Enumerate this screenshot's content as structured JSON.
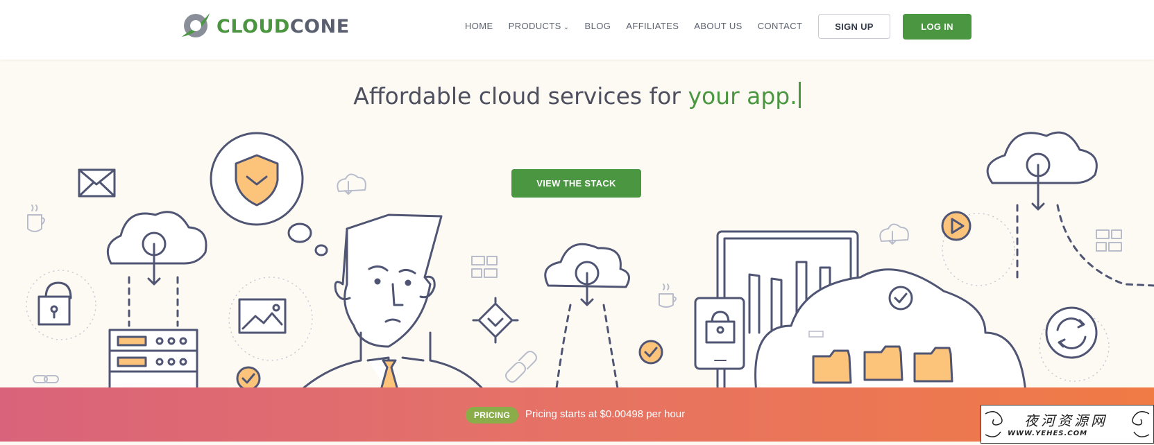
{
  "brand": {
    "logo_part1": "CLOUD",
    "logo_part2": "CONE",
    "green": "#4a9641"
  },
  "nav": {
    "items": [
      {
        "label": "HOME"
      },
      {
        "label": "PRODUCTS",
        "has_dropdown": true
      },
      {
        "label": "BLOG"
      },
      {
        "label": "AFFILIATES"
      },
      {
        "label": "ABOUT US"
      },
      {
        "label": "CONTACT"
      }
    ],
    "signup_label": "SIGN UP",
    "login_label": "LOG IN"
  },
  "hero": {
    "title_plain": "Affordable cloud services for ",
    "title_accent": "your app.",
    "cta_label": "VIEW THE STACK"
  },
  "banner": {
    "badge": "PRICING",
    "text": "Pricing starts at $0.00498 per hour",
    "gradient": [
      "#d9637a",
      "#f07b45"
    ]
  },
  "watermark": {
    "chinese": "夜河资源网",
    "url": "WWW.YEHES.COM"
  },
  "icons": [
    "logo-swoosh-icon",
    "envelope-icon",
    "shield-icon",
    "cloud-download-icon",
    "coffee-icon",
    "padlock-icon",
    "server-icon",
    "image-icon",
    "sitemap-icon",
    "diamond-check-icon",
    "link-icon",
    "check-circle-icon",
    "tablet-lock-icon",
    "bar-chart-icon",
    "folder-icon",
    "play-icon",
    "refresh-icon",
    "person-illustration"
  ]
}
